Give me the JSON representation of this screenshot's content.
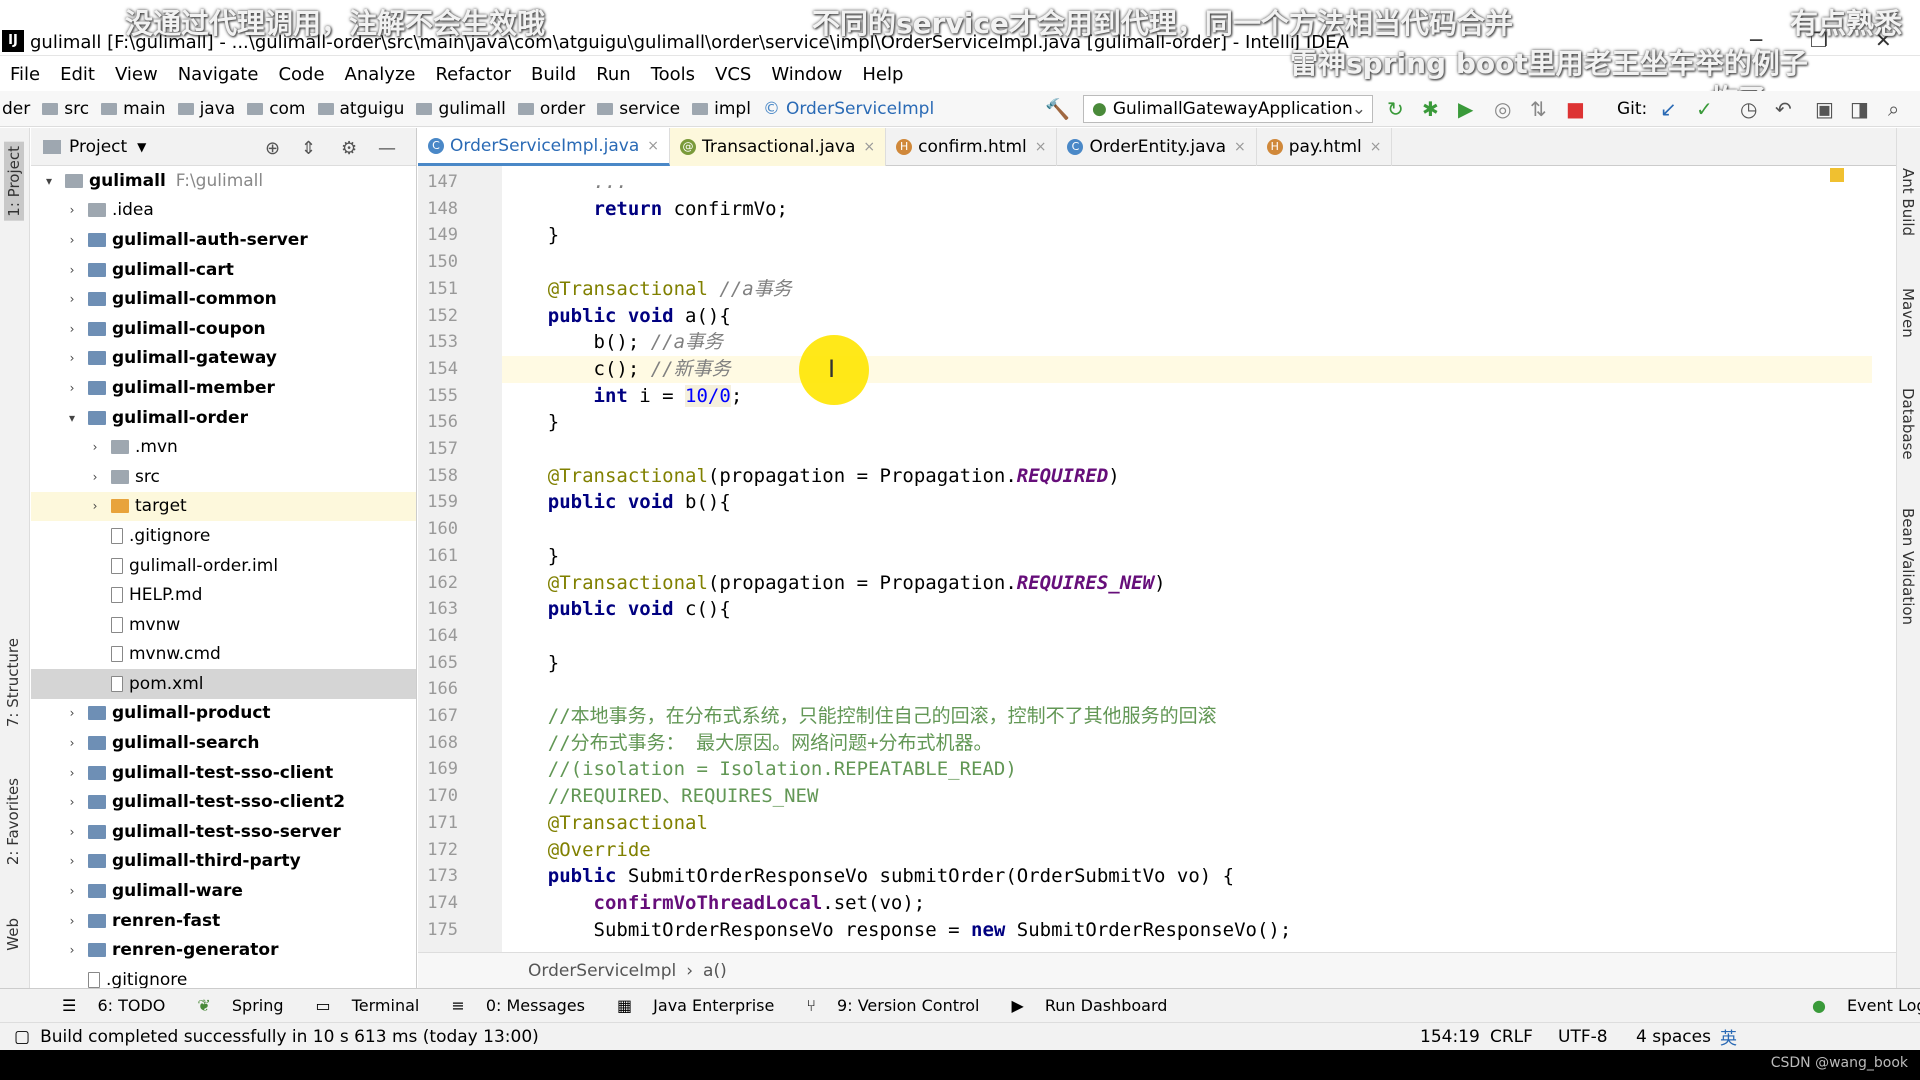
{
  "window": {
    "title": "gulimall [F:\\gulimall] - ...\\gulimall-order\\src\\main\\java\\com\\atguigu\\gulimall\\order\\service\\impl\\OrderServiceImpl.java [gulimall-order] - IntelliJ IDEA"
  },
  "subtitles": {
    "top_left": "没通过代理调用，注解不会生效哦",
    "top_mid": "不同的service才会用到代理，同一个方法相当代码合并",
    "top_right": "有点熟悉",
    "line2": "雷神spring boot里用老王坐车举的例子",
    "line3": "炸了"
  },
  "menu": [
    "File",
    "Edit",
    "View",
    "Navigate",
    "Code",
    "Analyze",
    "Refactor",
    "Build",
    "Run",
    "Tools",
    "VCS",
    "Window",
    "Help"
  ],
  "breadcrumbs": [
    "der",
    "src",
    "main",
    "java",
    "com",
    "atguigu",
    "gulimall",
    "order",
    "service",
    "impl",
    "OrderServiceImpl"
  ],
  "run_config": "GulimallGatewayApplication",
  "git_label": "Git:",
  "project_panel": {
    "title": "Project",
    "tree": [
      {
        "label": "gulimall",
        "extra": "F:\\gulimall",
        "level": 0,
        "arrow": "▾",
        "bold": true,
        "icon": "folder-icon"
      },
      {
        "label": ".idea",
        "level": 1,
        "arrow": "›",
        "icon": "folder-icon"
      },
      {
        "label": "gulimall-auth-server",
        "level": 1,
        "arrow": "›",
        "bold": true,
        "icon": "module-icon"
      },
      {
        "label": "gulimall-cart",
        "level": 1,
        "arrow": "›",
        "bold": true,
        "icon": "module-icon"
      },
      {
        "label": "gulimall-common",
        "level": 1,
        "arrow": "›",
        "bold": true,
        "icon": "module-icon"
      },
      {
        "label": "gulimall-coupon",
        "level": 1,
        "arrow": "›",
        "bold": true,
        "icon": "module-icon"
      },
      {
        "label": "gulimall-gateway",
        "level": 1,
        "arrow": "›",
        "bold": true,
        "icon": "module-icon"
      },
      {
        "label": "gulimall-member",
        "level": 1,
        "arrow": "›",
        "bold": true,
        "icon": "module-icon"
      },
      {
        "label": "gulimall-order",
        "level": 1,
        "arrow": "▾",
        "bold": true,
        "icon": "module-icon"
      },
      {
        "label": ".mvn",
        "level": 2,
        "arrow": "›",
        "icon": "folder-icon"
      },
      {
        "label": "src",
        "level": 2,
        "arrow": "›",
        "icon": "folder-icon"
      },
      {
        "label": "target",
        "level": 2,
        "arrow": "›",
        "icon": "folder-orange-icon",
        "hl": true
      },
      {
        "label": ".gitignore",
        "level": 2,
        "arrow": "",
        "icon": "file-icon"
      },
      {
        "label": "gulimall-order.iml",
        "level": 2,
        "arrow": "",
        "icon": "file-icon"
      },
      {
        "label": "HELP.md",
        "level": 2,
        "arrow": "",
        "icon": "file-icon"
      },
      {
        "label": "mvnw",
        "level": 2,
        "arrow": "",
        "icon": "file-icon"
      },
      {
        "label": "mvnw.cmd",
        "level": 2,
        "arrow": "",
        "icon": "file-icon"
      },
      {
        "label": "pom.xml",
        "level": 2,
        "arrow": "",
        "icon": "maven-file-icon",
        "sel": true
      },
      {
        "label": "gulimall-product",
        "level": 1,
        "arrow": "›",
        "bold": true,
        "icon": "module-icon"
      },
      {
        "label": "gulimall-search",
        "level": 1,
        "arrow": "›",
        "bold": true,
        "icon": "module-icon"
      },
      {
        "label": "gulimall-test-sso-client",
        "level": 1,
        "arrow": "›",
        "bold": true,
        "icon": "module-icon"
      },
      {
        "label": "gulimall-test-sso-client2",
        "level": 1,
        "arrow": "›",
        "bold": true,
        "icon": "module-icon"
      },
      {
        "label": "gulimall-test-sso-server",
        "level": 1,
        "arrow": "›",
        "bold": true,
        "icon": "module-icon"
      },
      {
        "label": "gulimall-third-party",
        "level": 1,
        "arrow": "›",
        "bold": true,
        "icon": "module-icon"
      },
      {
        "label": "gulimall-ware",
        "level": 1,
        "arrow": "›",
        "bold": true,
        "icon": "module-icon"
      },
      {
        "label": "renren-fast",
        "level": 1,
        "arrow": "›",
        "bold": true,
        "icon": "module-icon"
      },
      {
        "label": "renren-generator",
        "level": 1,
        "arrow": "›",
        "bold": true,
        "icon": "module-icon"
      },
      {
        "label": ".gitignore",
        "level": 1,
        "arrow": "",
        "icon": "file-icon"
      }
    ]
  },
  "tabs": [
    {
      "label": "OrderServiceImpl.java",
      "active": true,
      "badge": "C",
      "color": "#4a88c7"
    },
    {
      "label": "Transactional.java",
      "badge": "@",
      "color": "#7a9a3a",
      "hl": true
    },
    {
      "label": "confirm.html",
      "badge": "H",
      "color": "#d0883a"
    },
    {
      "label": "OrderEntity.java",
      "badge": "C",
      "color": "#4a88c7"
    },
    {
      "label": "pay.html",
      "badge": "H",
      "color": "#d0883a"
    }
  ],
  "left_tool_tabs": [
    "1: Project",
    "7: Structure",
    "2: Favorites",
    "Web"
  ],
  "right_tool_tabs": [
    "Ant Build",
    "Maven",
    "Database",
    "Bean Validation"
  ],
  "code": {
    "first_line": 147,
    "lines": [
      {
        "n": "147",
        "t": [
          {
            "s": "        ",
            "c": ""
          },
          {
            "s": "...",
            "c": "cm"
          }
        ]
      },
      {
        "n": "148",
        "t": [
          {
            "s": "        ",
            "c": ""
          },
          {
            "s": "return",
            "c": "kw"
          },
          {
            "s": " confirmVo;",
            "c": ""
          }
        ]
      },
      {
        "n": "149",
        "t": [
          {
            "s": "    }",
            "c": ""
          }
        ]
      },
      {
        "n": "150",
        "t": []
      },
      {
        "n": "151",
        "t": [
          {
            "s": "    ",
            "c": ""
          },
          {
            "s": "@Transactional",
            "c": "an"
          },
          {
            "s": " //a事务",
            "c": "cm"
          }
        ]
      },
      {
        "n": "152",
        "t": [
          {
            "s": "    ",
            "c": ""
          },
          {
            "s": "public void",
            "c": "kw"
          },
          {
            "s": " a(){",
            "c": ""
          }
        ]
      },
      {
        "n": "153",
        "t": [
          {
            "s": "        b(); ",
            "c": ""
          },
          {
            "s": "//a事务",
            "c": "cm"
          }
        ]
      },
      {
        "n": "154",
        "t": [
          {
            "s": "        c(); ",
            "c": ""
          },
          {
            "s": "//新事务",
            "c": "cm"
          }
        ],
        "cur": true
      },
      {
        "n": "155",
        "t": [
          {
            "s": "        ",
            "c": ""
          },
          {
            "s": "int",
            "c": "kw"
          },
          {
            "s": " i = ",
            "c": ""
          },
          {
            "s": "10/0",
            "c": "num"
          },
          {
            "s": ";",
            "c": ""
          }
        ]
      },
      {
        "n": "156",
        "t": [
          {
            "s": "    }",
            "c": ""
          }
        ]
      },
      {
        "n": "157",
        "t": []
      },
      {
        "n": "158",
        "t": [
          {
            "s": "    ",
            "c": ""
          },
          {
            "s": "@Transactional",
            "c": "an"
          },
          {
            "s": "(propagation = Propagation.",
            "c": ""
          },
          {
            "s": "REQUIRED",
            "c": "en"
          },
          {
            "s": ")",
            "c": ""
          }
        ]
      },
      {
        "n": "159",
        "t": [
          {
            "s": "    ",
            "c": ""
          },
          {
            "s": "public void",
            "c": "kw"
          },
          {
            "s": " b(){",
            "c": ""
          }
        ]
      },
      {
        "n": "160",
        "t": []
      },
      {
        "n": "161",
        "t": [
          {
            "s": "    }",
            "c": ""
          }
        ]
      },
      {
        "n": "162",
        "t": [
          {
            "s": "    ",
            "c": ""
          },
          {
            "s": "@Transactional",
            "c": "an"
          },
          {
            "s": "(propagation = Propagation.",
            "c": ""
          },
          {
            "s": "REQUIRES_NEW",
            "c": "en"
          },
          {
            "s": ")",
            "c": ""
          }
        ]
      },
      {
        "n": "163",
        "t": [
          {
            "s": "    ",
            "c": ""
          },
          {
            "s": "public void",
            "c": "kw"
          },
          {
            "s": " c(){",
            "c": ""
          }
        ]
      },
      {
        "n": "164",
        "t": []
      },
      {
        "n": "165",
        "t": [
          {
            "s": "    }",
            "c": ""
          }
        ]
      },
      {
        "n": "166",
        "t": []
      },
      {
        "n": "167",
        "t": [
          {
            "s": "    ",
            "c": ""
          },
          {
            "s": "//本地事务，在分布式系统，只能控制住自己的回滚，控制不了其他服务的回滚",
            "c": "cmg"
          }
        ]
      },
      {
        "n": "168",
        "t": [
          {
            "s": "    ",
            "c": ""
          },
          {
            "s": "//分布式事务： 最大原因。网络问题+分布式机器。",
            "c": "cmg"
          }
        ]
      },
      {
        "n": "169",
        "t": [
          {
            "s": "    ",
            "c": ""
          },
          {
            "s": "//(isolation = Isolation.REPEATABLE_READ)",
            "c": "cmg"
          }
        ]
      },
      {
        "n": "170",
        "t": [
          {
            "s": "    ",
            "c": ""
          },
          {
            "s": "//REQUIRED、REQUIRES_NEW",
            "c": "cmg"
          }
        ]
      },
      {
        "n": "171",
        "t": [
          {
            "s": "    ",
            "c": ""
          },
          {
            "s": "@Transactional",
            "c": "an"
          }
        ]
      },
      {
        "n": "172",
        "t": [
          {
            "s": "    ",
            "c": ""
          },
          {
            "s": "@Override",
            "c": "an"
          }
        ]
      },
      {
        "n": "173",
        "t": [
          {
            "s": "    ",
            "c": ""
          },
          {
            "s": "public",
            "c": "kw"
          },
          {
            "s": " SubmitOrderResponseVo submitOrder(OrderSubmitVo vo) {",
            "c": ""
          }
        ]
      },
      {
        "n": "174",
        "t": [
          {
            "s": "        ",
            "c": ""
          },
          {
            "s": "confirmVoThreadLocal",
            "c": "fl"
          },
          {
            "s": ".set(vo);",
            "c": ""
          }
        ]
      },
      {
        "n": "175",
        "t": [
          {
            "s": "        SubmitOrderResponseVo response = ",
            "c": ""
          },
          {
            "s": "new",
            "c": "kw"
          },
          {
            "s": " SubmitOrderResponseVo();",
            "c": ""
          }
        ]
      }
    ]
  },
  "editor_breadcrumb": [
    "OrderServiceImpl",
    "a()"
  ],
  "bottom_tools": [
    "6: TODO",
    "Spring",
    "Terminal",
    "0: Messages",
    "Java Enterprise",
    "9: Version Control",
    "Run Dashboard"
  ],
  "event_log": "Event Log",
  "status": {
    "message": "Build completed successfully in 10 s 613 ms (today 13:00)",
    "position": "154:19",
    "line_sep": "CRLF",
    "encoding": "UTF-8",
    "indent": "4 spaces",
    "ime": "英"
  },
  "watermark": "CSDN @wang_book"
}
